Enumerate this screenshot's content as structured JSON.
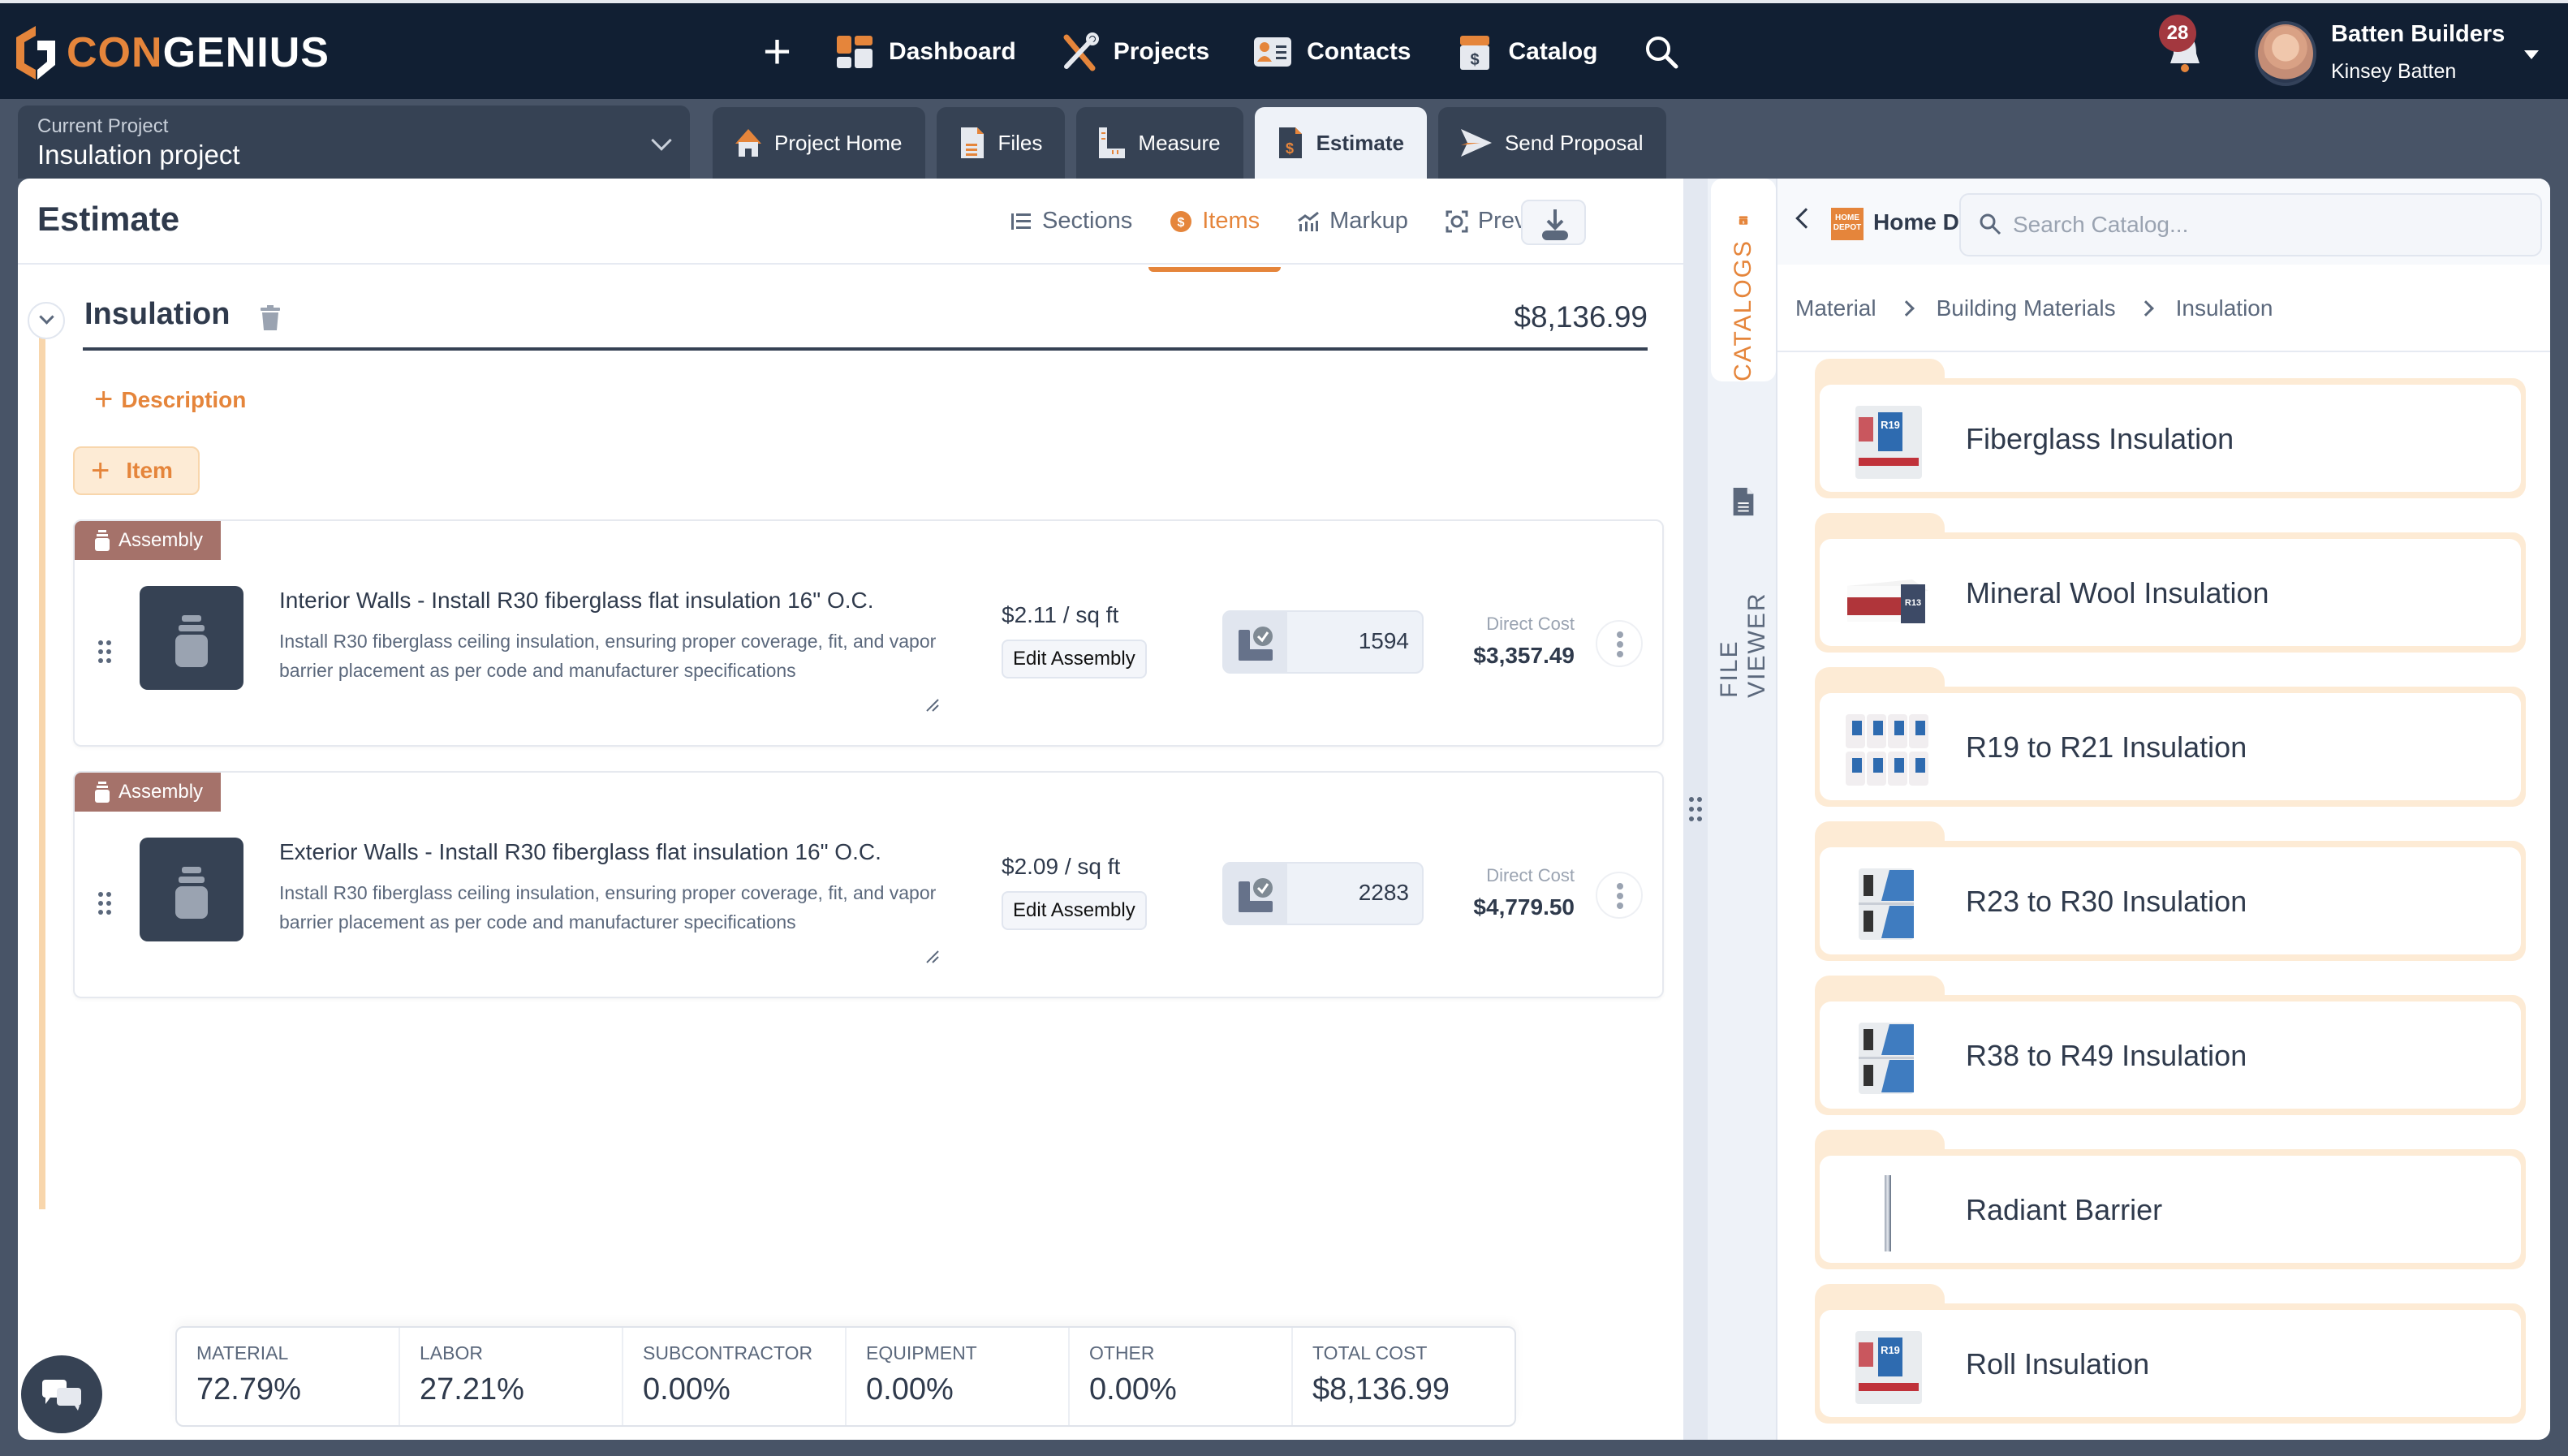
{
  "app": {
    "logo_prefix": "CON",
    "logo_suffix": "GENIUS",
    "colors": {
      "brand": "#e5853b",
      "nav_bg": "#111f33",
      "panel_dark": "#364254",
      "assembly_tag": "#a5726a",
      "badge": "#a3383f"
    }
  },
  "nav": {
    "add_icon": "plus-icon",
    "items": [
      {
        "label": "Dashboard",
        "icon": "dashboard-icon"
      },
      {
        "label": "Projects",
        "icon": "tools-icon"
      },
      {
        "label": "Contacts",
        "icon": "contact-card-icon"
      },
      {
        "label": "Catalog",
        "icon": "catalog-box-icon"
      }
    ],
    "search_icon": "search-icon",
    "notifications": {
      "icon": "bell-icon",
      "count": "28"
    },
    "user": {
      "company": "Batten Builders",
      "name": "Kinsey Batten"
    }
  },
  "project": {
    "label": "Current Project",
    "value": "Insulation project",
    "tabs": [
      {
        "label": "Project Home",
        "icon": "home-icon",
        "active": false
      },
      {
        "label": "Files",
        "icon": "file-icon",
        "active": false
      },
      {
        "label": "Measure",
        "icon": "ruler-icon",
        "active": false
      },
      {
        "label": "Estimate",
        "icon": "estimate-icon",
        "active": true
      },
      {
        "label": "Send Proposal",
        "icon": "send-icon",
        "active": false
      }
    ]
  },
  "estimate": {
    "title": "Estimate",
    "tabs": [
      {
        "label": "Sections",
        "icon": "sections-icon",
        "active": false
      },
      {
        "label": "Items",
        "icon": "dollar-badge-icon",
        "active": true
      },
      {
        "label": "Markup",
        "icon": "markup-chart-icon",
        "active": false
      },
      {
        "label": "Preview",
        "icon": "preview-icon",
        "active": false
      }
    ],
    "section": {
      "name": "Insulation",
      "total": "$8,136.99",
      "add_description": "Description",
      "add_item": "Item"
    },
    "assemblies": [
      {
        "tag": "Assembly",
        "title": "Interior Walls - Install R30 fiberglass flat insulation 16\" O.C.",
        "description": "Install R30 fiberglass ceiling insulation, ensuring proper coverage, fit, and vapor barrier placement as per code and manufacturer specifications",
        "unit_price": "$2.11 / sq ft",
        "edit_label": "Edit Assembly",
        "quantity": "1594",
        "direct_cost_label": "Direct Cost",
        "direct_cost": "$3,357.49"
      },
      {
        "tag": "Assembly",
        "title": "Exterior Walls - Install R30 fiberglass flat insulation 16\" O.C.",
        "description": "Install R30 fiberglass ceiling insulation, ensuring proper coverage, fit, and vapor barrier placement as per code and manufacturer specifications",
        "unit_price": "$2.09 / sq ft",
        "edit_label": "Edit Assembly",
        "quantity": "2283",
        "direct_cost_label": "Direct Cost",
        "direct_cost": "$4,779.50"
      }
    ],
    "summary": [
      {
        "label": "Material",
        "value": "72.79%"
      },
      {
        "label": "Labor",
        "value": "27.21%"
      },
      {
        "label": "Subcontractor",
        "value": "0.00%"
      },
      {
        "label": "Equipment",
        "value": "0.00%"
      },
      {
        "label": "Other",
        "value": "0.00%"
      },
      {
        "label": "Total Cost",
        "value": "$8,136.99"
      }
    ]
  },
  "side_tabs": [
    {
      "label": "CATALOGS",
      "icon": "catalog-box-icon",
      "active": true
    },
    {
      "label": "FILE VIEWER",
      "icon": "file-icon",
      "active": false
    }
  ],
  "catalog": {
    "store_logo": "HOME DEPOT",
    "store_name": "Home D...",
    "search_placeholder": "Search Catalog...",
    "search_value": "",
    "breadcrumb": [
      "Material",
      "Building Materials",
      "Insulation"
    ],
    "folders": [
      {
        "name": "Fiberglass Insulation",
        "image": "r19-roll-image"
      },
      {
        "name": "Mineral Wool Insulation",
        "image": "mineral-wool-pack-image"
      },
      {
        "name": "R19 to R21 Insulation",
        "image": "r19-rolls-stack-image"
      },
      {
        "name": "R23 to R30 Insulation",
        "image": "batt-bundle-image"
      },
      {
        "name": "R38 to R49 Insulation",
        "image": "batt-bundle-image"
      },
      {
        "name": "Radiant Barrier",
        "image": "radiant-barrier-image"
      },
      {
        "name": "Roll Insulation",
        "image": "r19-roll-image"
      }
    ]
  }
}
